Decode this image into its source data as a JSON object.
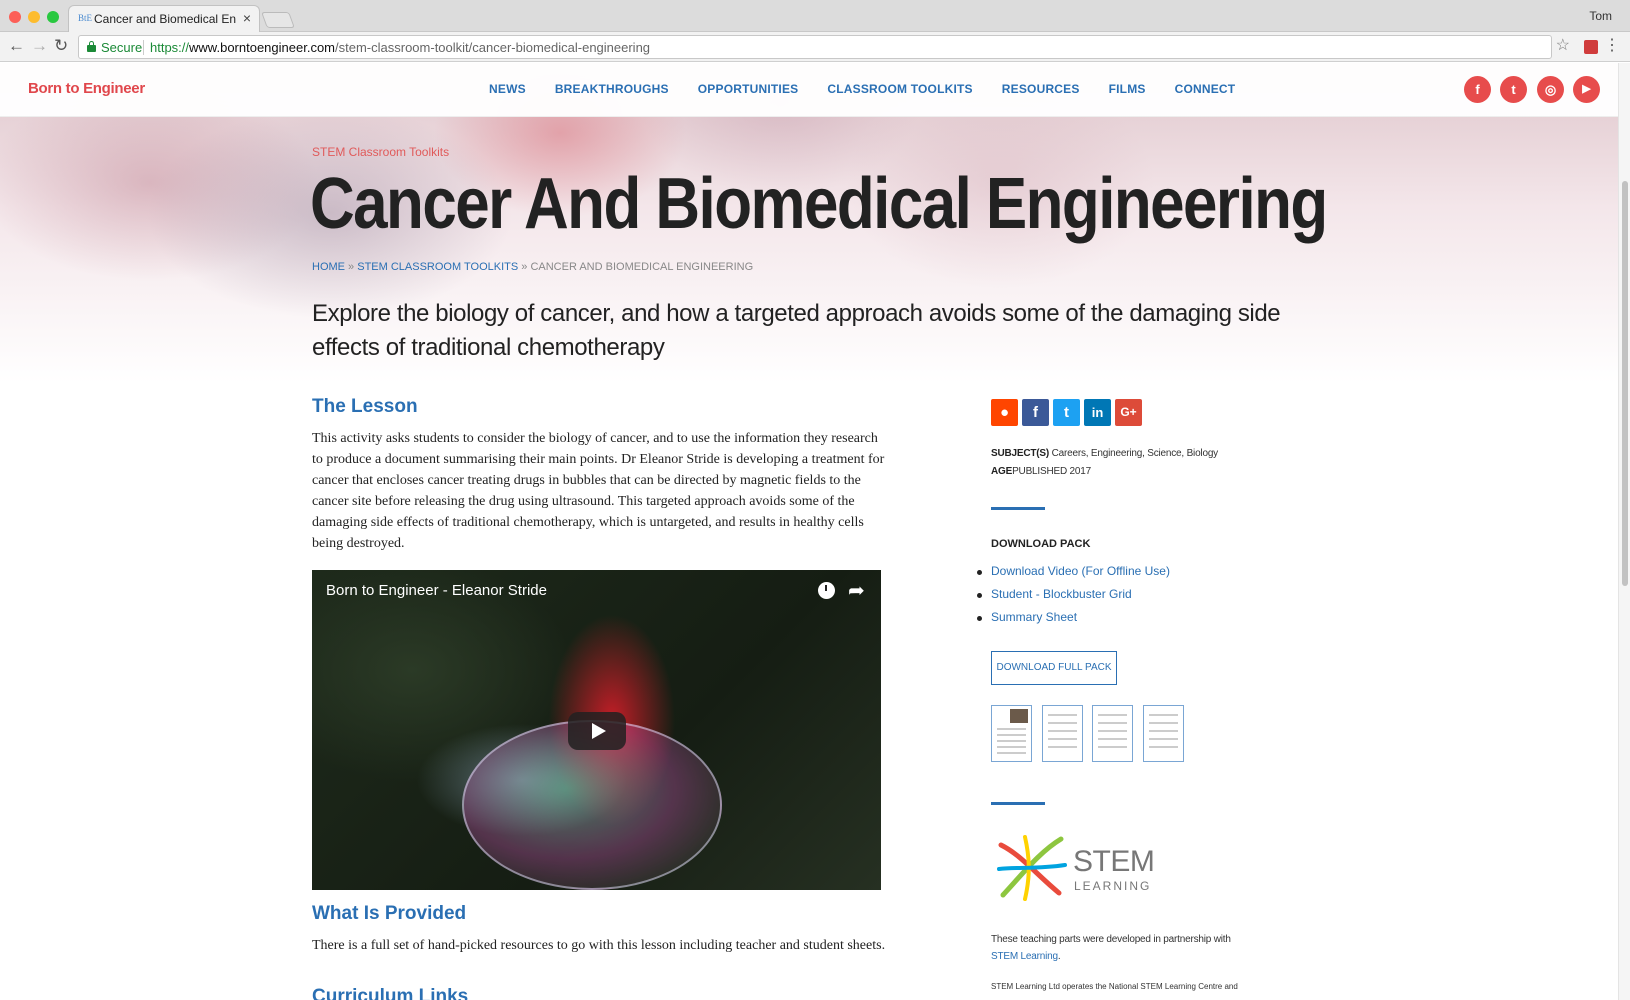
{
  "browser": {
    "tab_title": "Cancer and Biomedical Engine",
    "tab_favicon": "BtE",
    "user": "Tom",
    "secure_label": "Secure",
    "url_scheme": "https://",
    "url_host": "www.borntoengineer.com",
    "url_path": "/stem-classroom-toolkit/cancer-biomedical-engineering"
  },
  "site": {
    "logo": "Born to Engineer",
    "nav": [
      "NEWS",
      "BREAKTHROUGHS",
      "OPPORTUNITIES",
      "CLASSROOM TOOLKITS",
      "RESOURCES",
      "FILMS",
      "CONNECT"
    ],
    "social": [
      {
        "icon": "facebook-icon",
        "glyph": "f"
      },
      {
        "icon": "twitter-icon",
        "glyph": "t"
      },
      {
        "icon": "instagram-icon",
        "glyph": "◎"
      },
      {
        "icon": "youtube-icon",
        "glyph": "▶"
      }
    ]
  },
  "hero": {
    "kicker": "STEM Classroom Toolkits",
    "title": "Cancer And Biomedical Engineering",
    "breadcrumb": {
      "home": "HOME",
      "sep": " » ",
      "section": "STEM CLASSROOM TOOLKITS",
      "current": "CANCER AND BIOMEDICAL ENGINEERING"
    },
    "intro": "Explore the biology of cancer, and how a targeted approach avoids some of the damaging side effects of traditional chemotherapy"
  },
  "main": {
    "lesson_heading": "The Lesson",
    "lesson_text": "This activity asks students to consider the biology of cancer, and to use the information they research to produce a document summarising their main points. Dr Eleanor Stride is developing a treatment for cancer that encloses cancer treating drugs in bubbles that can be directed by magnetic fields to the cancer site before releasing the drug using ultrasound. This targeted approach avoids some of the damaging side effects of traditional chemotherapy, which is untargeted, and results in healthy cells being destroyed.",
    "video_title": "Born to Engineer - Eleanor Stride",
    "provided_heading": "What Is Provided",
    "provided_text": "There is a full set of hand-picked resources to go with this lesson including teacher and student sheets.",
    "curriculum_heading": "Curriculum Links"
  },
  "sidebar": {
    "share": [
      {
        "icon": "reddit-icon",
        "glyph": "●",
        "color": "#ff4500"
      },
      {
        "icon": "facebook-icon",
        "glyph": "f",
        "color": "#3b5998"
      },
      {
        "icon": "twitter-icon",
        "glyph": "t",
        "color": "#1da1f2"
      },
      {
        "icon": "linkedin-icon",
        "glyph": "in",
        "color": "#0077b5"
      },
      {
        "icon": "google-plus-icon",
        "glyph": "G+",
        "color": "#dd4b39"
      }
    ],
    "subjects_label": "SUBJECT(S)",
    "subjects_value": " Careers, Engineering, Science, Biology",
    "age_label": "AGE",
    "age_value": "PUBLISHED 2017",
    "download_heading": "DOWNLOAD PACK",
    "downloads": [
      "Download Video (For Offline Use)",
      "Student - Blockbuster Grid",
      "Summary Sheet"
    ],
    "download_button": "DOWNLOAD FULL PACK",
    "stem_logo_text": "STEM",
    "stem_logo_sub": "LEARNING",
    "partner_text": "These teaching parts were developed in partnership with",
    "partner_link": "STEM Learning",
    "partner_end": ".",
    "footnote": "STEM Learning Ltd operates the National STEM Learning Centre and"
  },
  "colors": {
    "brand_red": "#e0474c",
    "link_blue": "#2a6fb3"
  }
}
